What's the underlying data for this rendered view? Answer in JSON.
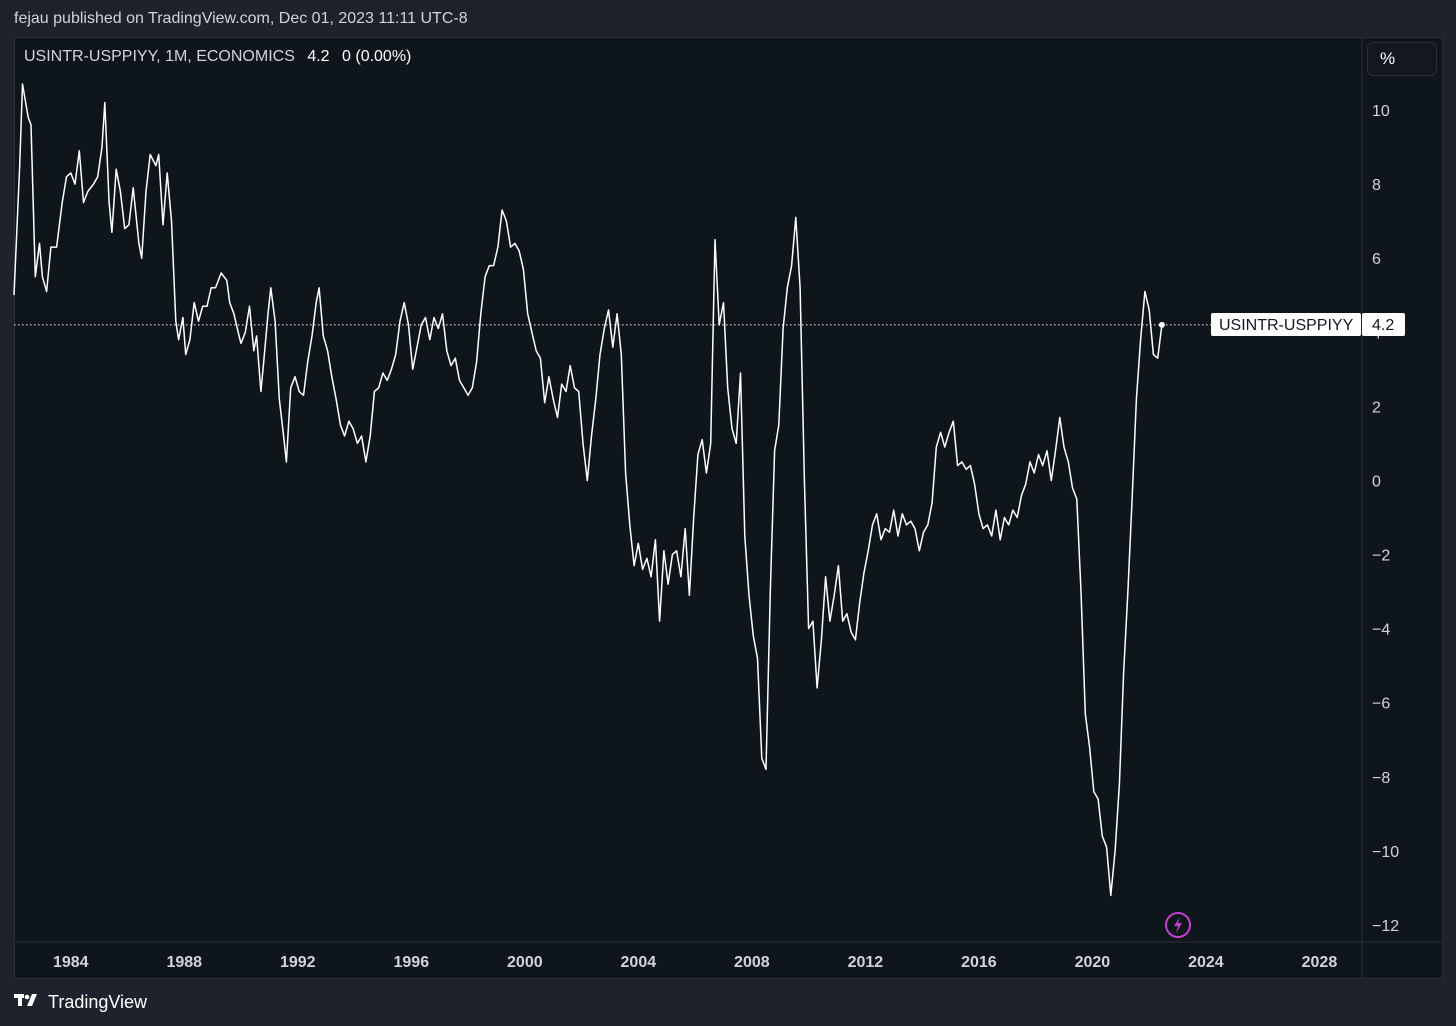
{
  "header": {
    "published_text": "fejau published on TradingView.com, Dec 01, 2023 11:11 UTC-8"
  },
  "legend": {
    "symbol_info": "USINTR-USPPIYY, 1M, ECONOMICS",
    "last_value": "4.2",
    "change": "0 (0.00%)"
  },
  "price_scale": {
    "unit_label": "%",
    "ticks": [
      "10",
      "8",
      "6",
      "4",
      "2",
      "0",
      "−2",
      "−4",
      "−6",
      "−8",
      "−10",
      "−12"
    ],
    "tick_values": [
      10,
      8,
      6,
      4,
      2,
      0,
      -2,
      -4,
      -6,
      -8,
      -10,
      -12
    ]
  },
  "time_scale": {
    "ticks": [
      "1984",
      "1988",
      "1992",
      "1996",
      "2000",
      "2004",
      "2008",
      "2012",
      "2016",
      "2020",
      "2024",
      "2028"
    ],
    "tick_years": [
      1984,
      1988,
      1992,
      1996,
      2000,
      2004,
      2008,
      2012,
      2016,
      2020,
      2024,
      2028
    ]
  },
  "last_price_label": {
    "series_name": "USINTR-USPPIYY",
    "value": "4.2"
  },
  "footer": {
    "brand": "TradingView"
  },
  "colors": {
    "background": "#0f161b",
    "line": "#ffffff",
    "accent_event": "#c13fd1"
  },
  "chart_data": {
    "type": "line",
    "title": "USINTR-USPPIYY, 1M, ECONOMICS",
    "xlabel": "",
    "ylabel": "",
    "ylim": [
      -12.5,
      11
    ],
    "xlim": [
      1982.0,
      2029.5
    ],
    "grid": false,
    "series": [
      {
        "name": "USINTR-USPPIYY",
        "points": [
          [
            1982.0,
            5.0
          ],
          [
            1982.2,
            8.5
          ],
          [
            1982.3,
            10.7
          ],
          [
            1982.5,
            9.8
          ],
          [
            1982.6,
            9.6
          ],
          [
            1982.75,
            5.5
          ],
          [
            1982.9,
            6.4
          ],
          [
            1983.0,
            5.5
          ],
          [
            1983.15,
            5.1
          ],
          [
            1983.3,
            6.3
          ],
          [
            1983.5,
            6.3
          ],
          [
            1983.7,
            7.5
          ],
          [
            1983.85,
            8.2
          ],
          [
            1984.0,
            8.3
          ],
          [
            1984.15,
            8.0
          ],
          [
            1984.3,
            8.9
          ],
          [
            1984.45,
            7.5
          ],
          [
            1984.6,
            7.8
          ],
          [
            1984.8,
            8.0
          ],
          [
            1984.95,
            8.2
          ],
          [
            1985.1,
            9.0
          ],
          [
            1985.2,
            10.2
          ],
          [
            1985.35,
            7.5
          ],
          [
            1985.45,
            6.7
          ],
          [
            1985.6,
            8.4
          ],
          [
            1985.75,
            7.8
          ],
          [
            1985.9,
            6.8
          ],
          [
            1986.05,
            6.9
          ],
          [
            1986.2,
            7.9
          ],
          [
            1986.4,
            6.4
          ],
          [
            1986.5,
            6.0
          ],
          [
            1986.65,
            7.8
          ],
          [
            1986.8,
            8.8
          ],
          [
            1987.0,
            8.5
          ],
          [
            1987.1,
            8.8
          ],
          [
            1987.25,
            6.9
          ],
          [
            1987.4,
            8.3
          ],
          [
            1987.55,
            7.0
          ],
          [
            1987.7,
            4.3
          ],
          [
            1987.8,
            3.8
          ],
          [
            1987.95,
            4.4
          ],
          [
            1988.05,
            3.4
          ],
          [
            1988.2,
            3.8
          ],
          [
            1988.35,
            4.8
          ],
          [
            1988.5,
            4.3
          ],
          [
            1988.65,
            4.7
          ],
          [
            1988.8,
            4.7
          ],
          [
            1988.95,
            5.2
          ],
          [
            1989.1,
            5.2
          ],
          [
            1989.3,
            5.6
          ],
          [
            1989.5,
            5.4
          ],
          [
            1989.6,
            4.8
          ],
          [
            1989.75,
            4.5
          ],
          [
            1989.9,
            4.0
          ],
          [
            1990.0,
            3.7
          ],
          [
            1990.15,
            4.0
          ],
          [
            1990.3,
            4.7
          ],
          [
            1990.45,
            3.5
          ],
          [
            1990.55,
            3.9
          ],
          [
            1990.7,
            2.4
          ],
          [
            1990.8,
            3.2
          ],
          [
            1990.95,
            4.5
          ],
          [
            1991.05,
            5.2
          ],
          [
            1991.2,
            4.3
          ],
          [
            1991.35,
            2.2
          ],
          [
            1991.5,
            1.2
          ],
          [
            1991.6,
            0.5
          ],
          [
            1991.75,
            2.5
          ],
          [
            1991.9,
            2.8
          ],
          [
            1992.05,
            2.4
          ],
          [
            1992.2,
            2.3
          ],
          [
            1992.35,
            3.2
          ],
          [
            1992.5,
            3.9
          ],
          [
            1992.65,
            4.8
          ],
          [
            1992.75,
            5.2
          ],
          [
            1992.9,
            3.9
          ],
          [
            1993.05,
            3.5
          ],
          [
            1993.2,
            2.8
          ],
          [
            1993.35,
            2.2
          ],
          [
            1993.5,
            1.5
          ],
          [
            1993.65,
            1.2
          ],
          [
            1993.8,
            1.6
          ],
          [
            1993.95,
            1.4
          ],
          [
            1994.1,
            1.0
          ],
          [
            1994.25,
            1.2
          ],
          [
            1994.4,
            0.5
          ],
          [
            1994.55,
            1.2
          ],
          [
            1994.7,
            2.4
          ],
          [
            1994.85,
            2.5
          ],
          [
            1995.0,
            2.9
          ],
          [
            1995.15,
            2.7
          ],
          [
            1995.3,
            3.0
          ],
          [
            1995.45,
            3.4
          ],
          [
            1995.6,
            4.3
          ],
          [
            1995.75,
            4.8
          ],
          [
            1995.9,
            4.2
          ],
          [
            1996.05,
            3.0
          ],
          [
            1996.2,
            3.6
          ],
          [
            1996.35,
            4.2
          ],
          [
            1996.5,
            4.4
          ],
          [
            1996.65,
            3.8
          ],
          [
            1996.8,
            4.4
          ],
          [
            1996.95,
            4.1
          ],
          [
            1997.1,
            4.5
          ],
          [
            1997.25,
            3.5
          ],
          [
            1997.4,
            3.1
          ],
          [
            1997.55,
            3.3
          ],
          [
            1997.7,
            2.7
          ],
          [
            1997.85,
            2.5
          ],
          [
            1998.0,
            2.3
          ],
          [
            1998.15,
            2.5
          ],
          [
            1998.3,
            3.2
          ],
          [
            1998.45,
            4.5
          ],
          [
            1998.6,
            5.5
          ],
          [
            1998.75,
            5.8
          ],
          [
            1998.9,
            5.8
          ],
          [
            1999.05,
            6.3
          ],
          [
            1999.2,
            7.3
          ],
          [
            1999.35,
            7.0
          ],
          [
            1999.5,
            6.3
          ],
          [
            1999.65,
            6.4
          ],
          [
            1999.8,
            6.2
          ],
          [
            1999.95,
            5.7
          ],
          [
            2000.1,
            4.5
          ],
          [
            2000.25,
            4.0
          ],
          [
            2000.4,
            3.5
          ],
          [
            2000.55,
            3.3
          ],
          [
            2000.7,
            2.1
          ],
          [
            2000.85,
            2.8
          ],
          [
            2001.0,
            2.2
          ],
          [
            2001.15,
            1.7
          ],
          [
            2001.3,
            2.6
          ],
          [
            2001.45,
            2.4
          ],
          [
            2001.6,
            3.1
          ],
          [
            2001.75,
            2.5
          ],
          [
            2001.9,
            2.4
          ],
          [
            2002.05,
            1.0
          ],
          [
            2002.2,
            0.0
          ],
          [
            2002.35,
            1.2
          ],
          [
            2002.5,
            2.2
          ],
          [
            2002.65,
            3.4
          ],
          [
            2002.8,
            4.1
          ],
          [
            2002.95,
            4.6
          ],
          [
            2003.1,
            3.6
          ],
          [
            2003.25,
            4.5
          ],
          [
            2003.4,
            3.4
          ],
          [
            2003.55,
            0.2
          ],
          [
            2003.7,
            -1.2
          ],
          [
            2003.85,
            -2.3
          ],
          [
            2004.0,
            -1.7
          ],
          [
            2004.15,
            -2.4
          ],
          [
            2004.3,
            -2.1
          ],
          [
            2004.45,
            -2.6
          ],
          [
            2004.6,
            -1.6
          ],
          [
            2004.75,
            -3.8
          ],
          [
            2004.9,
            -1.9
          ],
          [
            2005.05,
            -2.8
          ],
          [
            2005.2,
            -2.0
          ],
          [
            2005.35,
            -1.9
          ],
          [
            2005.5,
            -2.6
          ],
          [
            2005.65,
            -1.3
          ],
          [
            2005.8,
            -3.1
          ],
          [
            2005.95,
            -1.0
          ],
          [
            2006.1,
            0.7
          ],
          [
            2006.25,
            1.1
          ],
          [
            2006.4,
            0.2
          ],
          [
            2006.55,
            1.0
          ],
          [
            2006.7,
            6.5
          ],
          [
            2006.85,
            4.2
          ],
          [
            2007.0,
            4.8
          ],
          [
            2007.15,
            2.5
          ],
          [
            2007.3,
            1.4
          ],
          [
            2007.45,
            1.0
          ],
          [
            2007.6,
            2.9
          ],
          [
            2007.75,
            -1.5
          ],
          [
            2007.9,
            -3.1
          ],
          [
            2008.05,
            -4.2
          ],
          [
            2008.2,
            -4.8
          ],
          [
            2008.35,
            -7.5
          ],
          [
            2008.5,
            -7.8
          ],
          [
            2008.65,
            -3.0
          ],
          [
            2008.8,
            0.8
          ],
          [
            2008.95,
            1.5
          ],
          [
            2009.1,
            4.1
          ],
          [
            2009.25,
            5.2
          ],
          [
            2009.4,
            5.8
          ],
          [
            2009.55,
            7.1
          ],
          [
            2009.7,
            5.2
          ],
          [
            2009.85,
            0.0
          ],
          [
            2010.0,
            -4.0
          ],
          [
            2010.15,
            -3.8
          ],
          [
            2010.3,
            -5.6
          ],
          [
            2010.45,
            -4.3
          ],
          [
            2010.6,
            -2.6
          ],
          [
            2010.75,
            -3.8
          ],
          [
            2010.9,
            -3.1
          ],
          [
            2011.05,
            -2.3
          ],
          [
            2011.2,
            -3.8
          ],
          [
            2011.35,
            -3.6
          ],
          [
            2011.5,
            -4.1
          ],
          [
            2011.65,
            -4.3
          ],
          [
            2011.8,
            -3.3
          ],
          [
            2011.95,
            -2.5
          ],
          [
            2012.1,
            -1.9
          ],
          [
            2012.25,
            -1.2
          ],
          [
            2012.4,
            -0.9
          ],
          [
            2012.55,
            -1.6
          ],
          [
            2012.7,
            -1.3
          ],
          [
            2012.85,
            -1.4
          ],
          [
            2013.0,
            -0.8
          ],
          [
            2013.15,
            -1.5
          ],
          [
            2013.3,
            -0.9
          ],
          [
            2013.45,
            -1.2
          ],
          [
            2013.6,
            -1.1
          ],
          [
            2013.75,
            -1.3
          ],
          [
            2013.9,
            -1.9
          ],
          [
            2014.05,
            -1.4
          ],
          [
            2014.2,
            -1.2
          ],
          [
            2014.35,
            -0.6
          ],
          [
            2014.5,
            0.9
          ],
          [
            2014.65,
            1.3
          ],
          [
            2014.8,
            0.9
          ],
          [
            2014.95,
            1.3
          ],
          [
            2015.1,
            1.6
          ],
          [
            2015.25,
            0.4
          ],
          [
            2015.4,
            0.5
          ],
          [
            2015.55,
            0.3
          ],
          [
            2015.7,
            0.4
          ],
          [
            2015.85,
            -0.1
          ],
          [
            2016.0,
            -0.9
          ],
          [
            2016.15,
            -1.3
          ],
          [
            2016.3,
            -1.2
          ],
          [
            2016.45,
            -1.5
          ],
          [
            2016.6,
            -0.8
          ],
          [
            2016.75,
            -1.6
          ],
          [
            2016.9,
            -1.0
          ],
          [
            2017.05,
            -1.2
          ],
          [
            2017.2,
            -0.8
          ],
          [
            2017.35,
            -1.0
          ],
          [
            2017.5,
            -0.4
          ],
          [
            2017.65,
            -0.1
          ],
          [
            2017.8,
            0.5
          ],
          [
            2017.95,
            0.2
          ],
          [
            2018.1,
            0.7
          ],
          [
            2018.25,
            0.4
          ],
          [
            2018.4,
            0.8
          ],
          [
            2018.55,
            0.0
          ],
          [
            2018.7,
            0.8
          ],
          [
            2018.85,
            1.7
          ],
          [
            2019.0,
            0.9
          ],
          [
            2019.15,
            0.5
          ],
          [
            2019.3,
            -0.2
          ],
          [
            2019.45,
            -0.5
          ],
          [
            2019.6,
            -3.0
          ],
          [
            2019.75,
            -6.3
          ],
          [
            2019.9,
            -7.2
          ],
          [
            2020.05,
            -8.4
          ],
          [
            2020.2,
            -8.6
          ],
          [
            2020.35,
            -9.6
          ],
          [
            2020.5,
            -9.9
          ],
          [
            2020.65,
            -11.2
          ],
          [
            2020.8,
            -10.0
          ],
          [
            2020.95,
            -8.2
          ],
          [
            2021.1,
            -5.2
          ],
          [
            2021.25,
            -3.0
          ],
          [
            2021.4,
            -0.5
          ],
          [
            2021.55,
            2.2
          ],
          [
            2021.7,
            3.8
          ],
          [
            2021.85,
            5.1
          ],
          [
            2022.0,
            4.6
          ],
          [
            2022.15,
            3.4
          ],
          [
            2022.3,
            3.3
          ],
          [
            2022.45,
            4.2
          ]
        ]
      }
    ],
    "annotations": [
      {
        "type": "price_line",
        "value": 4.2,
        "label": "USINTR-USPPIYY"
      },
      {
        "type": "event_marker",
        "x": 2023.9,
        "icon": "lightning-icon"
      }
    ]
  }
}
